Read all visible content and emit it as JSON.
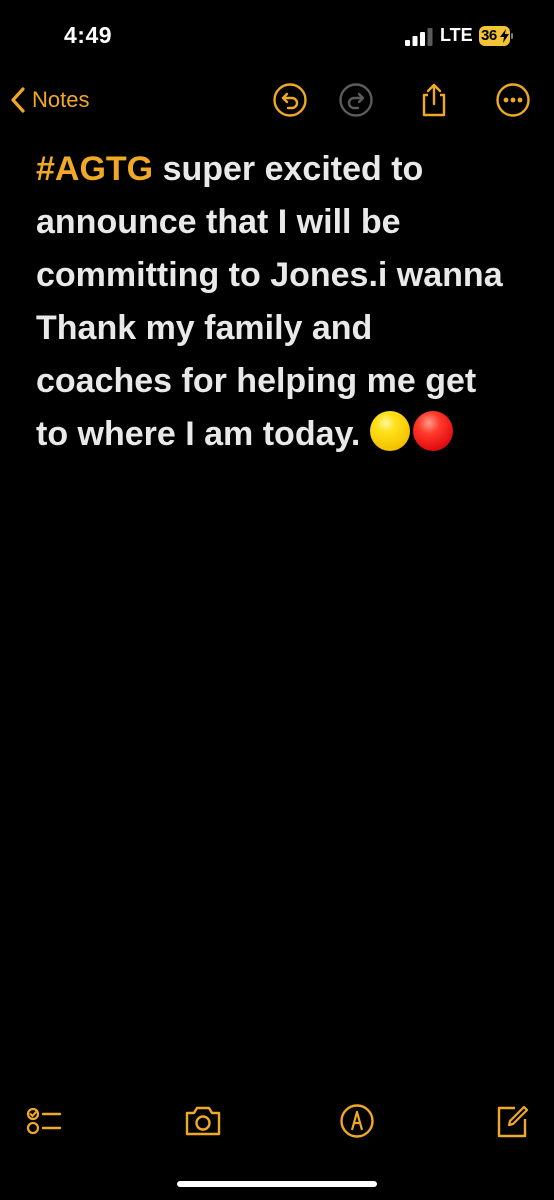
{
  "status_bar": {
    "time": "4:49",
    "carrier": "LTE",
    "battery": "36"
  },
  "nav": {
    "back_label": "Notes",
    "icons": [
      "chevron-left-icon",
      "undo-icon",
      "redo-icon",
      "share-icon",
      "more-icon"
    ]
  },
  "note": {
    "hashtag": "#AGTG",
    "text": " super excited to announce that I will be committing to Jones.i wanna Thank my family and coaches for helping me get to where I am today. ",
    "emojis": [
      "yellow-circle",
      "red-circle"
    ]
  },
  "toolbar": {
    "icons": [
      "checklist-icon",
      "camera-icon",
      "markup-pen-icon",
      "compose-icon"
    ]
  },
  "colors": {
    "accent": "#f0a925",
    "background": "#000000",
    "text": "#e9e9e9",
    "battery": "#f3c433"
  }
}
